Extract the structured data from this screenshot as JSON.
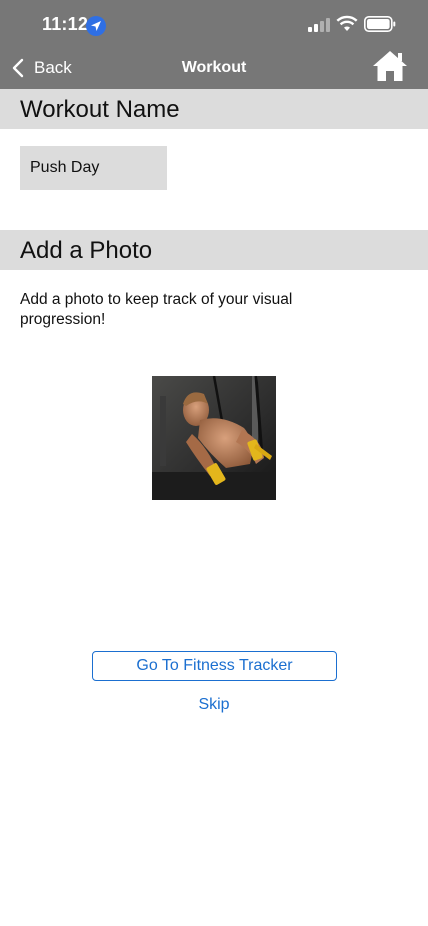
{
  "status_bar": {
    "time": "11:12"
  },
  "nav": {
    "back_label": "Back",
    "title": "Workout"
  },
  "workout_name": {
    "header": "Workout Name",
    "value": "Push Day"
  },
  "photo": {
    "header": "Add a Photo",
    "description": "Add a photo to keep track of your visual progression!"
  },
  "actions": {
    "tracker_label": "Go To Fitness Tracker",
    "skip_label": "Skip"
  },
  "colors": {
    "bar": "#777777",
    "section": "#dcdcdc",
    "accent": "#1b6fd0",
    "location": "#2f6fe4"
  }
}
